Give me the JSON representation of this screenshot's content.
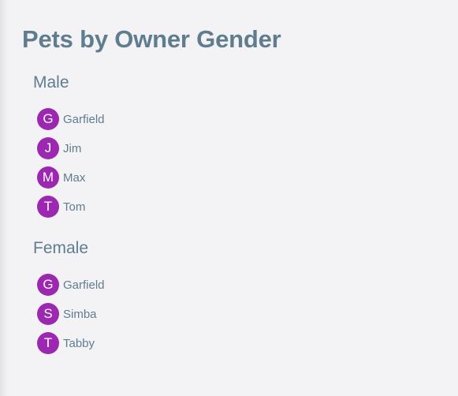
{
  "page": {
    "title": "Pets by Owner Gender"
  },
  "groups": [
    {
      "heading": "Male",
      "pets": [
        {
          "initial": "G",
          "name": "Garfield"
        },
        {
          "initial": "J",
          "name": "Jim"
        },
        {
          "initial": "M",
          "name": "Max"
        },
        {
          "initial": "T",
          "name": "Tom"
        }
      ]
    },
    {
      "heading": "Female",
      "pets": [
        {
          "initial": "G",
          "name": "Garfield"
        },
        {
          "initial": "S",
          "name": "Simba"
        },
        {
          "initial": "T",
          "name": "Tabby"
        }
      ]
    }
  ],
  "colors": {
    "background": "#f3f3f6",
    "text": "#5f7d8e",
    "avatar": "#9c27b0",
    "avatar_text": "#ffffff"
  }
}
